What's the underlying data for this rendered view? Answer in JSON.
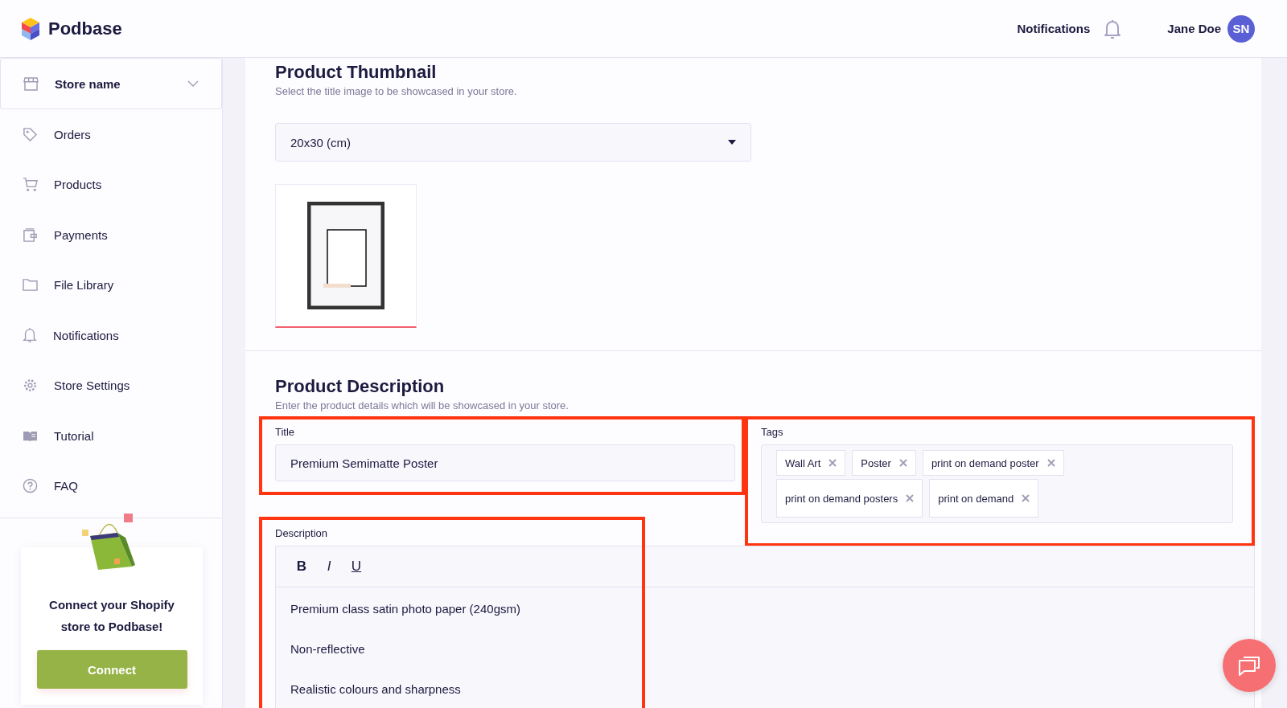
{
  "header": {
    "brand": "Podbase",
    "notifications_label": "Notifications",
    "user_name": "Jane Doe",
    "avatar_initials": "SN"
  },
  "sidebar": {
    "store": {
      "label": "Store name"
    },
    "items": [
      {
        "label": "Orders",
        "kind": "tag",
        "selected": false
      },
      {
        "label": "Products",
        "kind": "cart",
        "selected": false
      },
      {
        "label": "Payments",
        "kind": "wallet",
        "selected": false
      },
      {
        "label": "File Library",
        "kind": "folder",
        "selected": false
      },
      {
        "label": "Notifications",
        "kind": "bell",
        "selected": false
      },
      {
        "label": "Store Settings",
        "kind": "gear",
        "selected": false
      },
      {
        "label": "Tutorial",
        "kind": "book",
        "selected": false
      },
      {
        "label": "FAQ",
        "kind": "help",
        "selected": false
      }
    ],
    "promo": {
      "text": "Connect your Shopify store to Podbase!",
      "button": "Connect"
    }
  },
  "thumbnail_section": {
    "title": "Product Thumbnail",
    "subtitle": "Select the title image to be showcased in your store.",
    "size_select": {
      "value": "20x30 (cm)"
    },
    "thumbnails": [
      {
        "selected": true
      }
    ]
  },
  "description_section": {
    "title": "Product Description",
    "subtitle": "Enter the product details which will be showcased in your store.",
    "title_field": {
      "label": "Title",
      "value": "Premium Semimatte Poster",
      "highlighted": true
    },
    "tags_field": {
      "label": "Tags",
      "highlighted": true,
      "tags": [
        "Wall Art",
        "Poster",
        "print on demand poster",
        "print on demand posters",
        "print on demand"
      ]
    },
    "description_field": {
      "label": "Description",
      "highlighted": true,
      "toolbar": [
        {
          "kind": "bold",
          "label": "B"
        },
        {
          "kind": "italic",
          "label": "I"
        },
        {
          "kind": "underline",
          "label": "U"
        }
      ],
      "paragraphs": [
        "Premium class satin photo paper (240gsm)",
        "Non-reflective",
        "Realistic colours and sharpness"
      ]
    }
  }
}
